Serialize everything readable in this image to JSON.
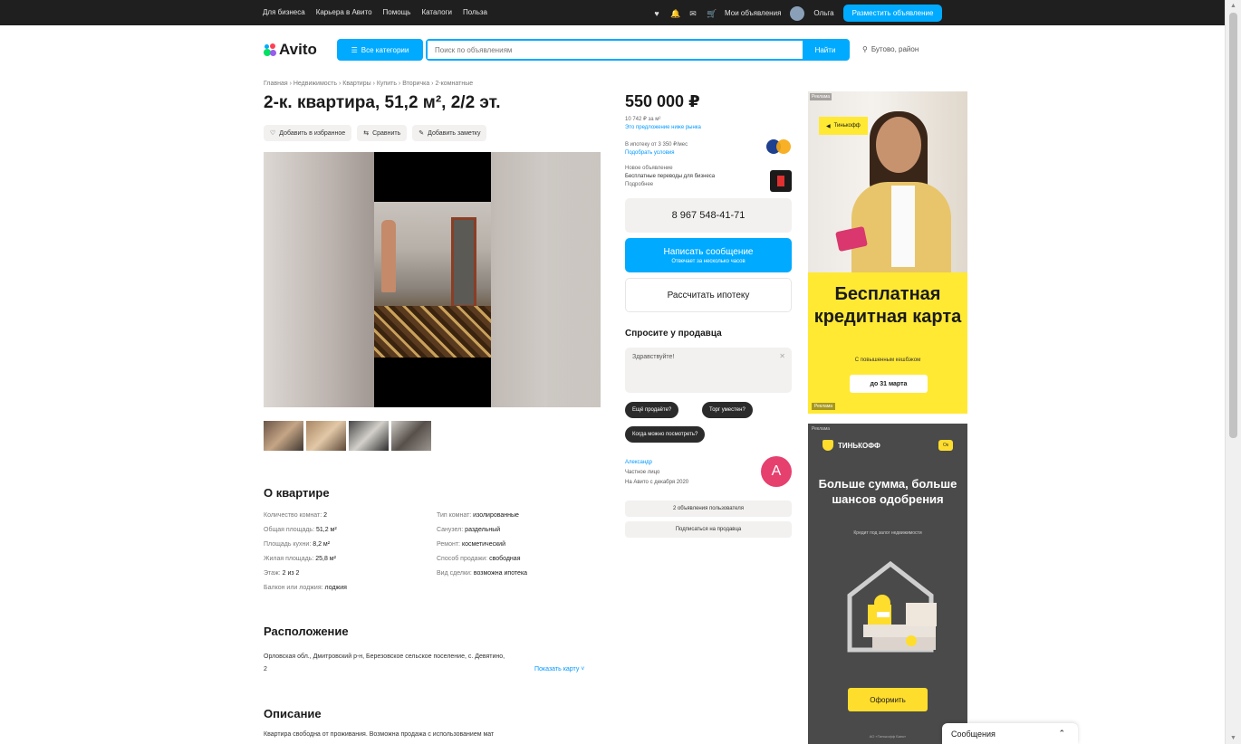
{
  "topbar": {
    "nav": [
      "Для бизнеса",
      "Карьера в Авито",
      "Помощь",
      "Каталоги",
      "Польза"
    ],
    "my_ads": "Мои объявления",
    "user": "Ольга",
    "post_button": "Разместить объявление"
  },
  "header": {
    "logo": "Avito",
    "categories_button": "Все категории",
    "search_placeholder": "Поиск по объявлениям",
    "search_button": "Найти",
    "location": "Бутово, район"
  },
  "listing": {
    "breadcrumbs": "Главная › Недвижимость › Квартиры › Купить › Вторичка › 2-комнатные",
    "title": "2-к. квартира, 51,2 м², 2/2 эт.",
    "actions": [
      "Добавить в избранное",
      "Сравнить",
      "Добавить заметку"
    ]
  },
  "about": {
    "heading": "О квартире",
    "left": [
      {
        "label": "Количество комнат:",
        "value": "2"
      },
      {
        "label": "Общая площадь:",
        "value": "51,2 м²"
      },
      {
        "label": "Площадь кухни:",
        "value": "8,2 м²"
      },
      {
        "label": "Жилая площадь:",
        "value": "25,8 м²"
      },
      {
        "label": "Этаж:",
        "value": "2 из 2"
      },
      {
        "label": "Балкон или лоджия:",
        "value": "лоджия"
      }
    ],
    "right": [
      {
        "label": "Тип комнат:",
        "value": "изолированные"
      },
      {
        "label": "Санузел:",
        "value": "раздельный"
      },
      {
        "label": "Ремонт:",
        "value": "косметический"
      },
      {
        "label": "Способ продажи:",
        "value": "свободная"
      },
      {
        "label": "Вид сделки:",
        "value": "возможна ипотека"
      }
    ]
  },
  "location": {
    "heading": "Расположение",
    "address": "Орловская обл., Дмитровский р-н, Березовское сельское поселение, с. Девятино, 2",
    "map_link": "Показать карту ˅"
  },
  "description": {
    "heading": "Описание",
    "text": "Квартира свободна от проживания. Возможна продажа с использованием мат"
  },
  "sidebar": {
    "price": "550 000 ₽",
    "price_per_m": "10 742 ₽ за м²",
    "price_link": "Это предложение ниже рынка",
    "mortgage_line1": "В ипотеку от 3 350 ₽/мес",
    "mortgage_link": "Подобрать условия",
    "service_label": "Новое объявление",
    "service_line": "Бесплатные переводы для бизнеса",
    "service_sub": "Подробнее",
    "phone": "8 967 548-41-71",
    "write_button": "Написать сообщение",
    "write_sub": "Отвечает за несколько часов",
    "mortgage_button": "Рассчитать ипотеку",
    "ask_heading": "Спросите у продавца",
    "ask_text": "Здравствуйте!",
    "chips": [
      "Ещё продаёте?",
      "Торг уместен?",
      "Когда можно посмотреть?"
    ],
    "seller_name": "Александр",
    "seller_type": "Частное лицо",
    "seller_since": "На Авито с декабря 2020",
    "seller_initial": "А",
    "seller_btn1": "2 объявления пользователя",
    "seller_btn2": "Подписаться на продавца"
  },
  "ad1": {
    "tag": "Реклама",
    "badge": "Тинькофф",
    "headline": "Бесплатная кредитная карта",
    "sub": "С повышенным кешбэком",
    "cta": "до 31 марта"
  },
  "ad2": {
    "top_tag": "Реклама",
    "brand": "ТИНЬКОФФ",
    "pill": "Ок",
    "headline": "Больше сумма, больше шансов одобрения",
    "sub": "Кредит под залог недвижимости",
    "cta": "Оформить",
    "fine": "АО «Тинькофф Банк»"
  },
  "messages": {
    "label": "Сообщения"
  },
  "colors": {
    "accent": "#00aaff",
    "ad_yellow": "#ffe933",
    "avatar": "#e6406f"
  }
}
